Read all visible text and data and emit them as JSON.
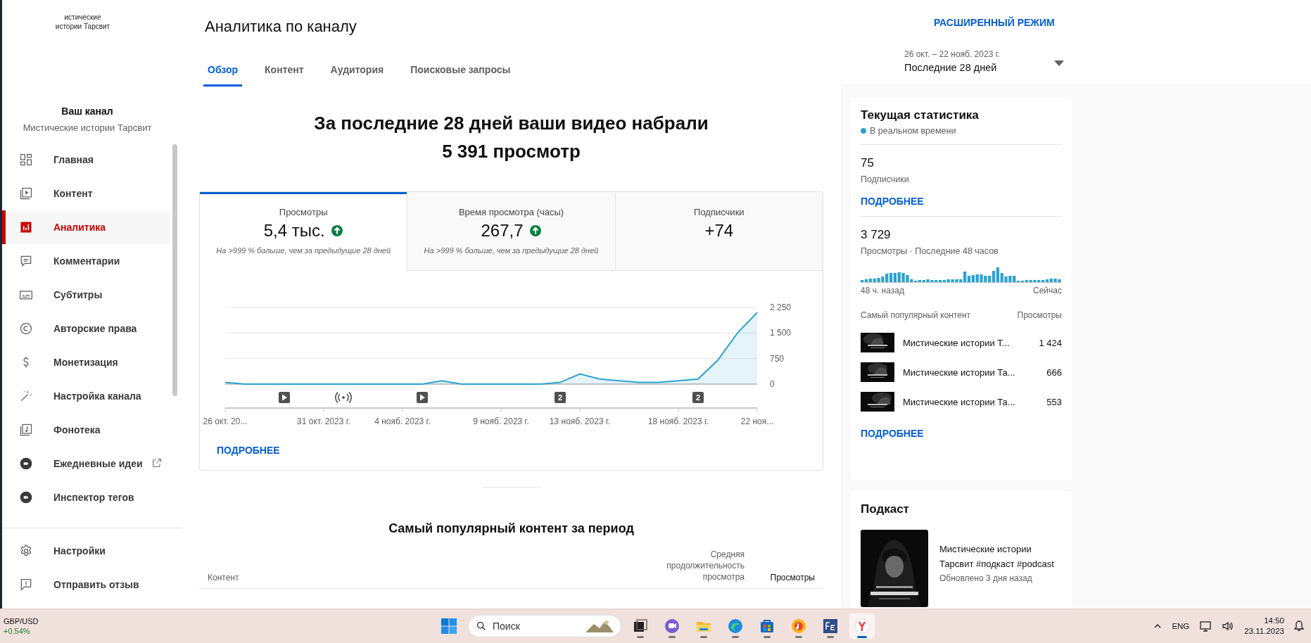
{
  "channel_header": {
    "logo_lines": [
      "истические",
      "истории Тарсвит"
    ]
  },
  "sidebar": {
    "title": "Ваш канал",
    "channel_name": "Мистические истории Тарсвит",
    "items": [
      {
        "label": "Главная",
        "selected": false,
        "external": false
      },
      {
        "label": "Контент",
        "selected": false,
        "external": false
      },
      {
        "label": "Аналитика",
        "selected": true,
        "external": false
      },
      {
        "label": "Комментарии",
        "selected": false,
        "external": false
      },
      {
        "label": "Субтитры",
        "selected": false,
        "external": false
      },
      {
        "label": "Авторские права",
        "selected": false,
        "external": false
      },
      {
        "label": "Монетизация",
        "selected": false,
        "external": false
      },
      {
        "label": "Настройка канала",
        "selected": false,
        "external": false
      },
      {
        "label": "Фонотека",
        "selected": false,
        "external": false
      },
      {
        "label": "Ежедневные идеи",
        "selected": false,
        "external": true
      },
      {
        "label": "Инспектор тегов",
        "selected": false,
        "external": false
      }
    ],
    "footer_items": [
      {
        "label": "Настройки"
      },
      {
        "label": "Отправить отзыв"
      }
    ]
  },
  "header": {
    "title": "Аналитика по каналу",
    "tabs": [
      {
        "label": "Обзор",
        "selected": true
      },
      {
        "label": "Контент",
        "selected": false
      },
      {
        "label": "Аудитория",
        "selected": false
      },
      {
        "label": "Поисковые запросы",
        "selected": false
      }
    ],
    "advanced_mode": "РАСШИРЕННЫЙ РЕЖИМ",
    "date_range": "26 окт. – 22 нояб. 2023 г.",
    "period": "Последние 28 дней"
  },
  "overview": {
    "headline": [
      "За последние 28 дней ваши видео набрали",
      "5 391 просмотр"
    ],
    "metrics": [
      {
        "label": "Просмотры",
        "value": "5,4 тыс.",
        "trend_up": true,
        "note": "На >999 % больше, чем за предыдущие 28 дней",
        "selected": true
      },
      {
        "label": "Время просмотра (часы)",
        "value": "267,7",
        "trend_up": true,
        "note": "На >999 % больше, чем за предыдущие 28 дней",
        "selected": false
      },
      {
        "label": "Подписчики",
        "value": "+74",
        "trend_up": false,
        "selected": false
      }
    ],
    "chart_data": {
      "type": "area",
      "categories": [
        "26 окт. 20...",
        null,
        null,
        null,
        null,
        "31 окт. 2023 г.",
        null,
        null,
        null,
        "4 нояб. 2023 г.",
        null,
        null,
        null,
        null,
        "9 нояб. 2023 г.",
        null,
        null,
        null,
        "13 нояб. 2023 г.",
        null,
        null,
        null,
        null,
        "18 нояб. 2023 г.",
        null,
        null,
        null,
        "22 ноя..."
      ],
      "series": [
        {
          "color": "#2ba3d1",
          "values": [
            50,
            0,
            0,
            0,
            0,
            0,
            0,
            0,
            0,
            0,
            0,
            100,
            0,
            0,
            0,
            0,
            0,
            50,
            300,
            150,
            100,
            50,
            50,
            100,
            150,
            700,
            1500,
            2100
          ]
        }
      ],
      "ylim": [
        0,
        2250
      ],
      "yticks": [
        {
          "value": 0,
          "label": "0"
        },
        {
          "value": 750,
          "label": "750"
        },
        {
          "value": 1500,
          "label": "1 500"
        },
        {
          "value": 2250,
          "label": "2 250"
        }
      ],
      "annotations": [
        "2",
        "2"
      ]
    },
    "more_link": "ПОДРОБНЕЕ"
  },
  "top_content": {
    "title": "Самый популярный контент за период",
    "columns": [
      {
        "label": "Контент",
        "selected": false
      },
      {
        "label": "Средняя продолжительность просмотра",
        "selected": false
      },
      {
        "label": "Просмотры",
        "selected": true
      }
    ]
  },
  "realtime": {
    "title": "Текущая статистика",
    "live_label": "В реальном времени",
    "subscribers": {
      "value": "75",
      "label": "Подписчики",
      "link": "ПОДРОБНЕЕ"
    },
    "views": {
      "value": "3 729",
      "label": "Просмотры · Последние 48 часов",
      "start_label": "48 ч. назад",
      "end_label": "Сейчас"
    },
    "top_header": [
      "Самый популярный контент",
      "Просмотры"
    ],
    "top_rows": [
      {
        "title": "Мистические истории Т...",
        "views": "1 424"
      },
      {
        "title": "Мистические истории Та...",
        "views": "666"
      },
      {
        "title": "Мистические истории Та...",
        "views": "553"
      }
    ],
    "link": "ПОДРОБНЕЕ"
  },
  "podcast": {
    "title": "Подкаст",
    "name": "Мистические истории Тарсвит #подкаст #podcast",
    "updated": "Обновлено 3 дня назад"
  },
  "taskbar": {
    "ticker": "GBP/USD",
    "ticker_change": "+0.54%",
    "search_placeholder": "Поиск",
    "apps": [
      {
        "active": false
      },
      {
        "active": false
      },
      {
        "active": false
      },
      {
        "active": false
      },
      {
        "active": false
      },
      {
        "active": false
      },
      {
        "active": false
      },
      {
        "active": true
      }
    ],
    "language": "ENG",
    "time": "14:50",
    "date": "23.11.2023"
  }
}
